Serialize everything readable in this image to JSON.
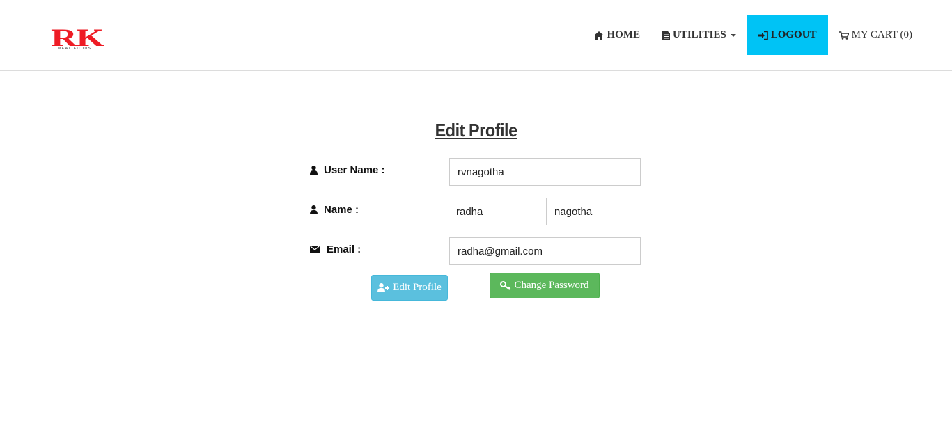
{
  "brand": {
    "logo_text": "RK",
    "logo_subtext": "MEAT FOODS",
    "logo_color": "#ee1c25"
  },
  "nav": {
    "home_label": "HOME",
    "utilities_label": "UTILITIES",
    "logout_label": "LOGOUT",
    "cart_label": "MY CART (0)",
    "logout_bg": "#00c3f5"
  },
  "page": {
    "title": "Edit Profile"
  },
  "form": {
    "username_label": "User Name :",
    "username_value": "rvnagotha",
    "name_label": "Name :",
    "first_name_value": "radha",
    "last_name_value": "nagotha",
    "email_label": "Email :",
    "email_value": "radha@gmail.com"
  },
  "buttons": {
    "edit_profile_label": "Edit Profile",
    "change_password_label": "Change Password",
    "edit_color": "#5bc0de",
    "password_color": "#5cb85c"
  },
  "icons": {
    "home": "home-icon",
    "utilities": "file-icon",
    "logout": "sign-in-icon",
    "cart": "cart-icon",
    "user": "user-icon",
    "email": "envelope-icon",
    "edit": "user-plus-icon",
    "password": "key-icon"
  }
}
